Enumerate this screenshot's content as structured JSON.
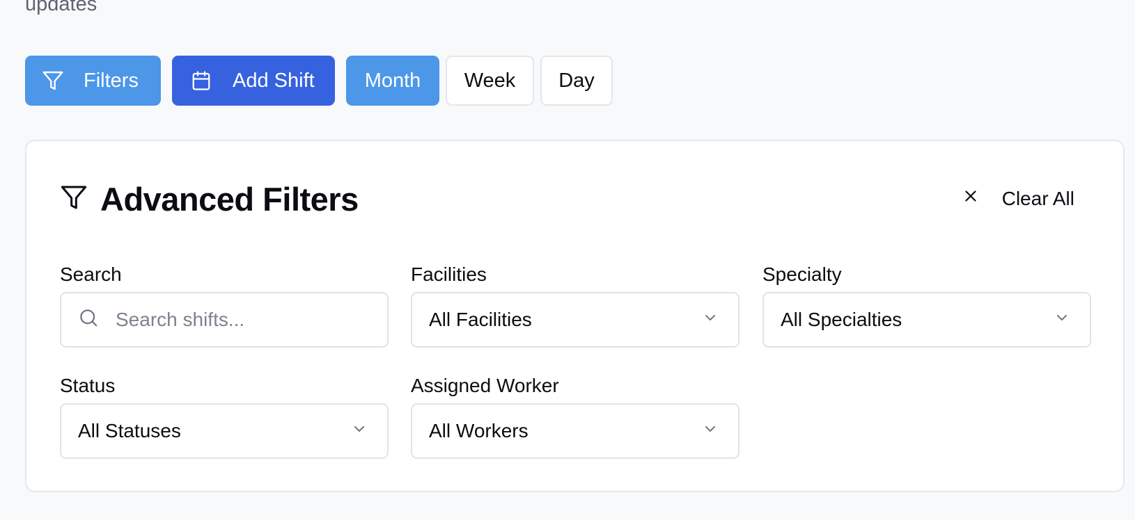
{
  "header": {
    "partial_text": "updates"
  },
  "toolbar": {
    "filters_label": "Filters",
    "add_shift_label": "Add Shift",
    "views": {
      "month": "Month",
      "week": "Week",
      "day": "Day"
    },
    "active_view": "Month"
  },
  "filters_panel": {
    "title": "Advanced Filters",
    "clear_all_label": "Clear All",
    "search": {
      "label": "Search",
      "placeholder": "Search shifts...",
      "value": ""
    },
    "facilities": {
      "label": "Facilities",
      "value": "All Facilities"
    },
    "specialty": {
      "label": "Specialty",
      "value": "All Specialties"
    },
    "status": {
      "label": "Status",
      "value": "All Statuses"
    },
    "assigned_worker": {
      "label": "Assigned Worker",
      "value": "All Workers"
    }
  },
  "icons": {
    "filter": "filter-icon",
    "calendar": "calendar-icon",
    "close": "close-icon",
    "search": "search-icon",
    "chevron": "chevron-down-icon"
  },
  "colors": {
    "primary_light": "#4c97e8",
    "primary": "#3662e0",
    "background": "#f8f9fb",
    "border": "#e0e3e8"
  }
}
